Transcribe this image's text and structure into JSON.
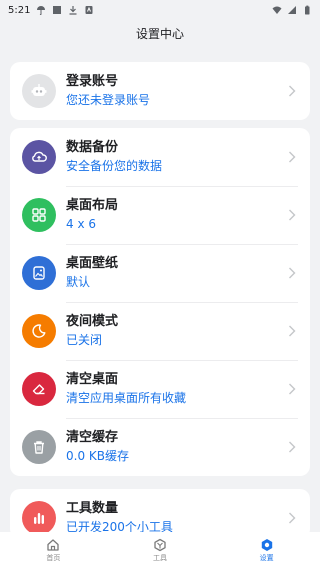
{
  "status_bar": {
    "time": "5:21"
  },
  "header": {
    "title": "设置中心"
  },
  "login": {
    "title": "登录账号",
    "subtitle": "您还未登录账号"
  },
  "settings": [
    {
      "title": "数据备份",
      "subtitle": "安全备份您的数据",
      "color": "#5b54a3",
      "icon": "cloud-backup-icon"
    },
    {
      "title": "桌面布局",
      "subtitle": "4 x 6",
      "color": "#2fbf5f",
      "icon": "grid-layout-icon"
    },
    {
      "title": "桌面壁纸",
      "subtitle": "默认",
      "color": "#2f6fd6",
      "icon": "wallpaper-icon"
    },
    {
      "title": "夜间模式",
      "subtitle": "已关闭",
      "color": "#f57c00",
      "icon": "moon-icon"
    },
    {
      "title": "清空桌面",
      "subtitle": "清空应用桌面所有收藏",
      "color": "#d9283f",
      "icon": "eraser-icon"
    },
    {
      "title": "清空缓存",
      "subtitle": "0.0 KB缓存",
      "color": "#9aa0a4",
      "icon": "trash-icon"
    }
  ],
  "tools": {
    "title": "工具数量",
    "subtitle": "已开发200个小工具",
    "color": "#f05a5a",
    "icon": "bar-chart-icon"
  },
  "nav": [
    {
      "label": "首页",
      "icon": "home-icon"
    },
    {
      "label": "工具",
      "icon": "toolbox-icon"
    },
    {
      "label": "设置",
      "icon": "settings-icon"
    }
  ],
  "colors": {
    "accent": "#1a73e8",
    "background": "#f1f2f4"
  }
}
